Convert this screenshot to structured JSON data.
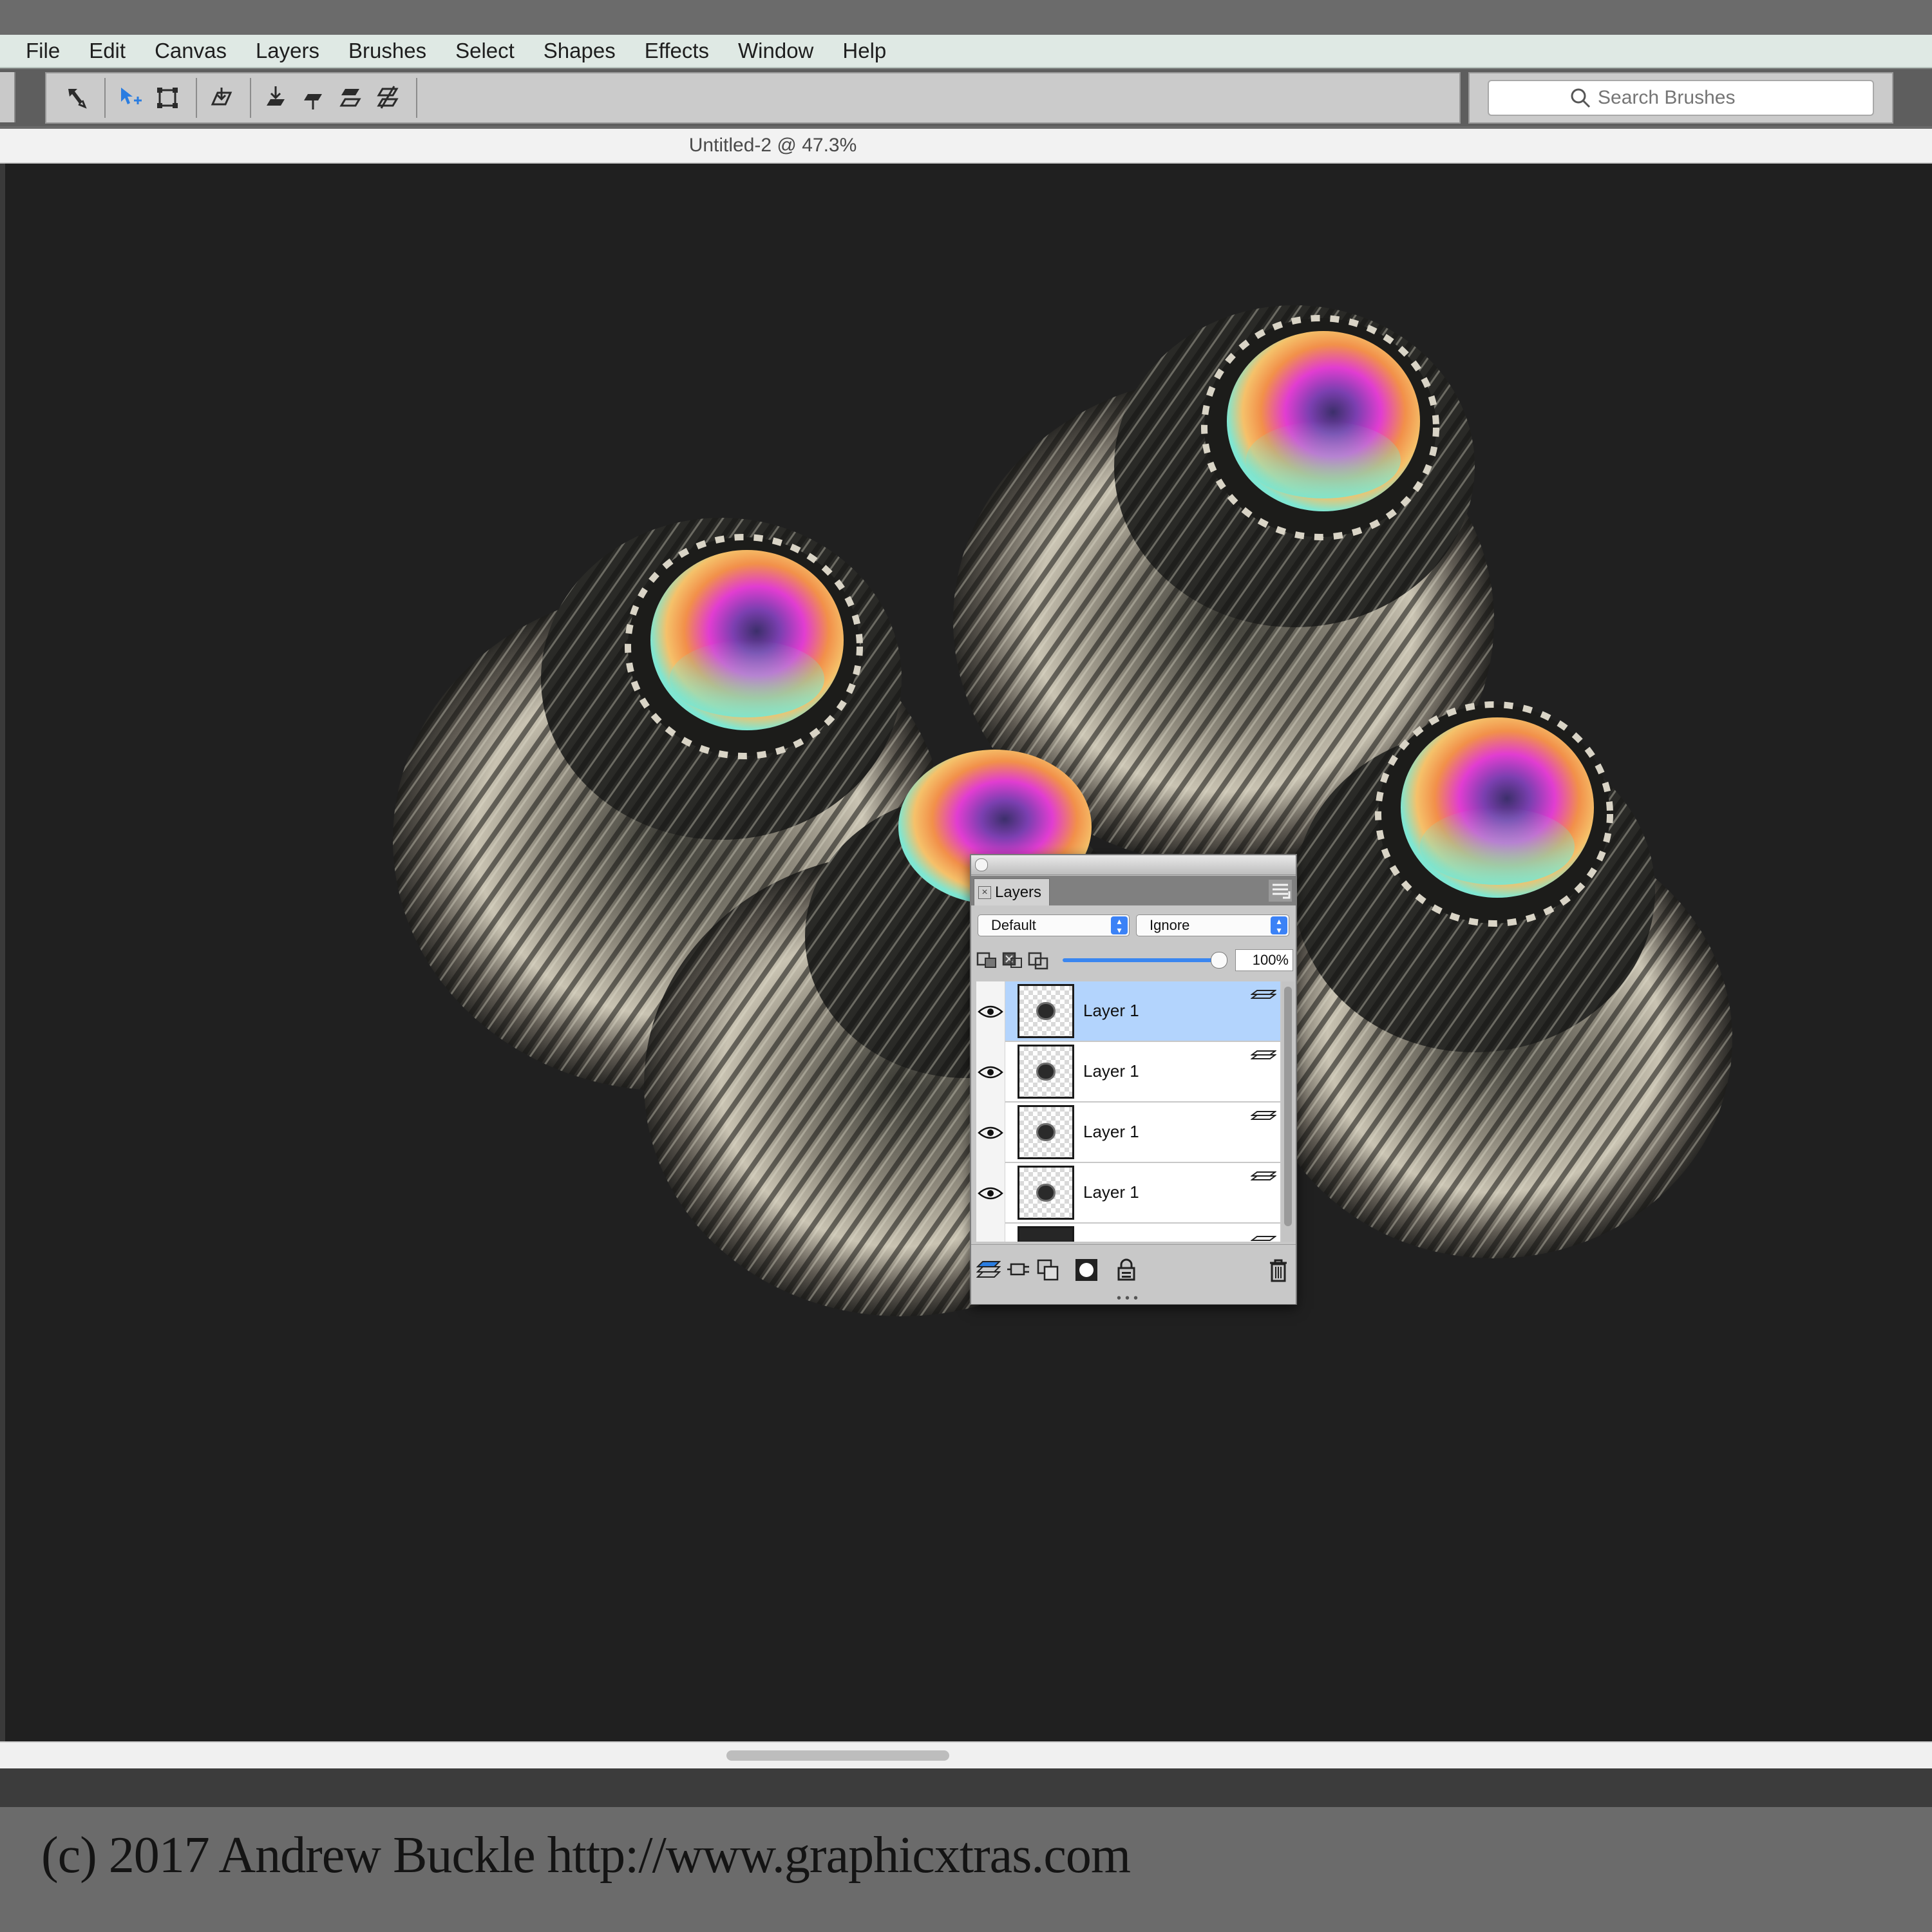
{
  "menubar": {
    "items": [
      "File",
      "Edit",
      "Canvas",
      "Layers",
      "Brushes",
      "Select",
      "Shapes",
      "Effects",
      "Window",
      "Help"
    ]
  },
  "toolbar": {
    "tools": [
      "transform-tool-icon",
      "move-arrow-icon",
      "selection-box-icon",
      "layer-transform-icon",
      "drop-layer-icon",
      "lift-layer-icon",
      "layer-shift-icon",
      "layer-adjust-icon"
    ]
  },
  "search": {
    "placeholder": "Search Brushes"
  },
  "document": {
    "title": "Untitled-2 @ 47.3%"
  },
  "layers_panel": {
    "tab_label": "Layers",
    "composite_method": "Default",
    "preserve_mode": "Ignore",
    "opacity": "100%",
    "opacity_value": 100,
    "layers": [
      {
        "name": "Layer 1",
        "selected": true
      },
      {
        "name": "Layer 1",
        "selected": false
      },
      {
        "name": "Layer 1",
        "selected": false
      },
      {
        "name": "Layer 1",
        "selected": false
      },
      {
        "name": "",
        "selected": false
      }
    ]
  },
  "footer": {
    "copyright": "(c) 2017 Andrew Buckle http://www.graphicxtras.com"
  },
  "colors": {
    "menubar_bg": "#dfe9e4",
    "canvas_bg": "#202020",
    "selection_blue": "#b3d4fd",
    "accent_blue": "#3b82f6"
  }
}
